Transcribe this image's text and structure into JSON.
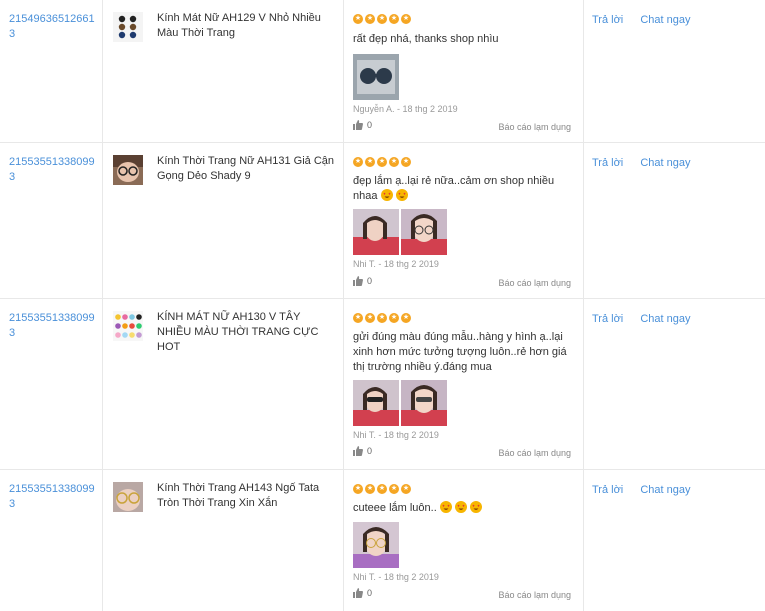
{
  "actions": {
    "reply_label": "Trả lời",
    "chat_label": "Chat ngay"
  },
  "report_label": "Báo cáo lạm dụng",
  "icons": {
    "star": "star-icon",
    "like": "thumbs-up-icon",
    "emoji": "heart-eyes-emoji-icon"
  },
  "colors": {
    "link": "#4a90d9",
    "star": "#f5a623",
    "border": "#e8e8e8"
  },
  "rows": [
    {
      "order_id": "215496365126613",
      "product_name": "Kính Mát Nữ AH129 V Nhỏ Nhiều Màu Thời Trang",
      "rating": 5,
      "comment": "rất đẹp nhá, thanks shop nhìu",
      "photo_count": 1,
      "meta": "Nguyễn A. - 18 thg 2 2019",
      "likes": "0"
    },
    {
      "order_id": "215535513380993",
      "product_name": "Kính Thời Trang Nữ AH131 Giả Cận Gọng Dẻo Shady 9",
      "rating": 5,
      "comment": "đẹp lắm ạ..lại rẻ nữa..cảm ơn shop nhiều nhaa",
      "photo_count": 2,
      "meta": "Nhi T. - 18 thg 2 2019",
      "likes": "0"
    },
    {
      "order_id": "215535513380993",
      "product_name": "KÍNH MÁT NỮ AH130 V TÂY NHIỀU MÀU THỜI TRANG CỰC HOT",
      "rating": 5,
      "comment": "gửi đúng màu đúng mẫu..hàng y hình ạ..lại xinh hơn mức tưởng tượng luôn..rẻ hơn giá thị trường nhiều ý.đáng mua",
      "photo_count": 2,
      "meta": "Nhi T. - 18 thg 2 2019",
      "likes": "0"
    },
    {
      "order_id": "215535513380993",
      "product_name": "Kính Thời Trang AH143 Ngố Tata Tròn Thời Trang Xin Xắn",
      "rating": 5,
      "comment": "cuteee lắm luôn..",
      "photo_count": 1,
      "meta": "Nhi T. - 18 thg 2 2019",
      "likes": "0"
    }
  ]
}
